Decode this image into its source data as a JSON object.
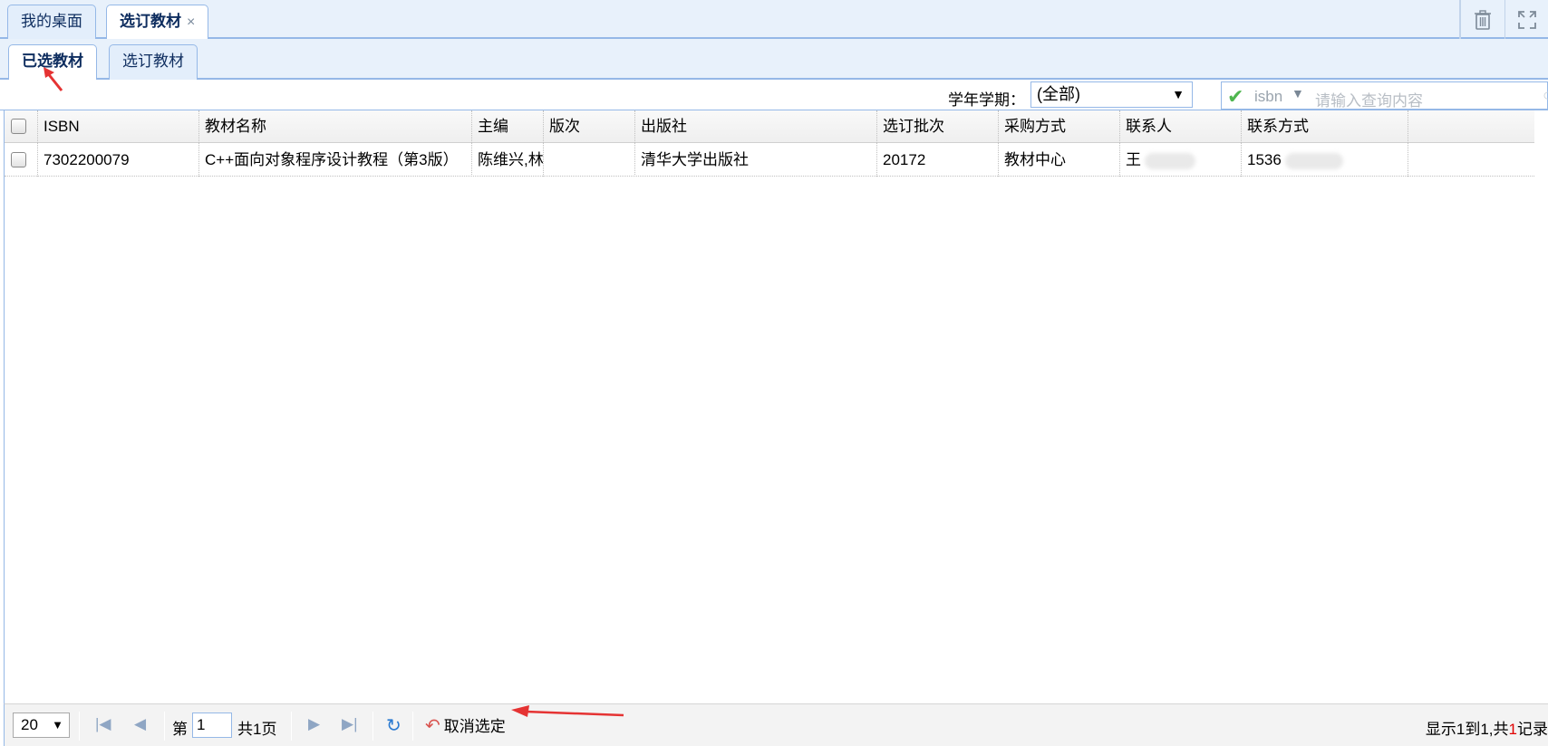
{
  "top_tabs": [
    {
      "label": "我的桌面"
    },
    {
      "label": "选订教材",
      "close": "×"
    }
  ],
  "inner_tabs": [
    {
      "label": "已选教材"
    },
    {
      "label": "选订教材"
    }
  ],
  "filter": {
    "term_label": "学年学期：",
    "term_value": "(全部)",
    "search_field": "isbn",
    "search_placeholder": "请输入查询内容"
  },
  "grid": {
    "columns": [
      "ISBN",
      "教材名称",
      "主编",
      "版次",
      "出版社",
      "选订批次",
      "采购方式",
      "联系人",
      "联系方式"
    ],
    "rows": [
      {
        "isbn": "7302200079",
        "name": "C++面向对象程序设计教程（第3版）",
        "editor": "陈维兴,林·",
        "edition": "",
        "publisher": "清华大学出版社",
        "batch": "20172",
        "purchase": "教材中心",
        "contact": "王",
        "phone": "1536"
      }
    ]
  },
  "pager": {
    "page_size": "20",
    "page_prefix": "第",
    "page_number": "1",
    "page_total": "共1页",
    "cancel_label": "取消选定",
    "info_prefix": "显示1到1,共",
    "info_count": "1",
    "info_suffix": "记录"
  },
  "colors": {
    "tab_border": "#95b8e7",
    "tab_bg": "#e8f1fb",
    "annotation_arrow": "#e53333"
  }
}
